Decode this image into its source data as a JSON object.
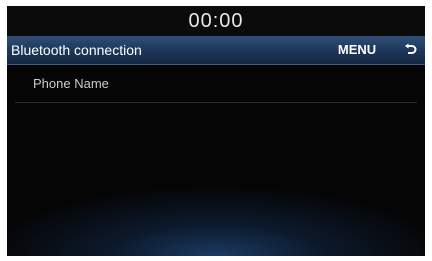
{
  "status_bar": {
    "clock": "00:00"
  },
  "header": {
    "title": "Bluetooth connection",
    "menu_label": "MENU",
    "back_icon": "back-arrow-icon"
  },
  "list": {
    "items": [
      {
        "label": "Phone Name"
      }
    ]
  },
  "colors": {
    "header_blue": "#1d3557",
    "background": "#050506",
    "text_primary": "#ffffff"
  }
}
